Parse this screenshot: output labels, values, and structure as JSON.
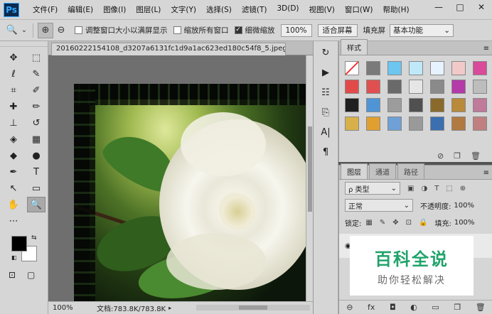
{
  "app": {
    "logo": "Ps"
  },
  "menu": [
    "文件(F)",
    "编辑(E)",
    "图像(I)",
    "图层(L)",
    "文字(Y)",
    "选择(S)",
    "滤镜(T)",
    "3D(D)",
    "视图(V)",
    "窗口(W)",
    "帮助(H)"
  ],
  "window_controls": {
    "minimize": "—",
    "maximize": "□",
    "close": "✕"
  },
  "options": {
    "tool_icon": "🔍",
    "tool_dropdown": "⌄",
    "zoom_in": "⊕",
    "zoom_out": "⊖",
    "resize_windows": {
      "label": "调整窗口大小以满屏显示",
      "checked": false
    },
    "zoom_all": {
      "label": "缩放所有窗口",
      "checked": false
    },
    "scrubby": {
      "label": "细微缩放",
      "checked": true
    },
    "zoom_100": "100%",
    "fit_screen": "适合屏幕",
    "fill_screen": "填充屏",
    "workspace": "基本功能",
    "workspace_arrow": "⌄"
  },
  "document": {
    "tab_title": "20160222154108_d3207a6131fc1d9a1ac623ed180c54f8_5.jpeg...",
    "tab_close": "×",
    "zoom": "100%",
    "info": "文档:783.8K/783.8K",
    "info_arrow": "▸"
  },
  "tools": [
    {
      "name": "move-tool",
      "glyph": "✥"
    },
    {
      "name": "marquee-tool",
      "glyph": "⬚"
    },
    {
      "name": "lasso-tool",
      "glyph": "ℓ"
    },
    {
      "name": "quick-select-tool",
      "glyph": "✎"
    },
    {
      "name": "crop-tool",
      "glyph": "⌗"
    },
    {
      "name": "eyedropper-tool",
      "glyph": "✐"
    },
    {
      "name": "healing-tool",
      "glyph": "✚"
    },
    {
      "name": "brush-tool",
      "glyph": "✏"
    },
    {
      "name": "stamp-tool",
      "glyph": "⊥"
    },
    {
      "name": "history-brush-tool",
      "glyph": "↺"
    },
    {
      "name": "eraser-tool",
      "glyph": "◈"
    },
    {
      "name": "gradient-tool",
      "glyph": "▦"
    },
    {
      "name": "blur-tool",
      "glyph": "◆"
    },
    {
      "name": "dodge-tool",
      "glyph": "●"
    },
    {
      "name": "pen-tool",
      "glyph": "✒"
    },
    {
      "name": "type-tool",
      "glyph": "T"
    },
    {
      "name": "path-select-tool",
      "glyph": "↖"
    },
    {
      "name": "shape-tool",
      "glyph": "▭"
    },
    {
      "name": "hand-tool",
      "glyph": "✋"
    },
    {
      "name": "zoom-tool",
      "glyph": "🔍"
    },
    {
      "name": "more-tools",
      "glyph": "⋯"
    }
  ],
  "colors": {
    "foreground": "#000000",
    "background": "#ffffff",
    "swap": "⇆",
    "default": "◧"
  },
  "toolbox_bottom": {
    "quickmask": "⊡",
    "screenmode": "▢"
  },
  "panel_strip": [
    "↻",
    "▶",
    "☷",
    "⎘",
    "A|",
    "¶"
  ],
  "styles_panel": {
    "tab": "样式",
    "menu": "≡",
    "swatches": [
      "#ffffff",
      "#7a7a7a",
      "#6cc6f0",
      "#bfe8f8",
      "#e6f2ff",
      "#f2c9c9",
      "#d94a9a",
      "#e24a4a",
      "#e05050",
      "#6a6a6a",
      "#e6e6e6",
      "#8a8a8a",
      "#b33aa8",
      "#bdbdbd",
      "#1f1f1f",
      "#4f95d6",
      "#9c9c9c",
      "#505050",
      "#8a6a2a",
      "#b88a3a",
      "#c07a9a",
      "#d8b04a",
      "#e0a030",
      "#6fa0d6",
      "#9a9a9a",
      "#3a6fb0",
      "#b07a40",
      "#c08080"
    ],
    "footer": [
      "⊘",
      "❐",
      "🗑"
    ]
  },
  "layers_panel": {
    "tabs": [
      "图层",
      "通道",
      "路径"
    ],
    "menu": "≡",
    "filter_label": "ρ 类型",
    "filter_arrow": "⌄",
    "filter_icons": [
      "▣",
      "◑",
      "T",
      "⬚",
      "⊕"
    ],
    "blend_mode": "正常",
    "blend_arrow": "⌄",
    "opacity_label": "不透明度:",
    "opacity_value": "100%",
    "lock_label": "锁定:",
    "lock_icons": [
      "▦",
      "✎",
      "✥",
      "⊡",
      "🔒"
    ],
    "fill_label": "填充:",
    "fill_value": "100%",
    "eye": "◉",
    "footer": [
      "⊖",
      "fx",
      "◘",
      "◐",
      "▭",
      "❐",
      "🗑"
    ]
  },
  "watermark": {
    "title": "百科全说",
    "subtitle": "助你轻松解决"
  }
}
